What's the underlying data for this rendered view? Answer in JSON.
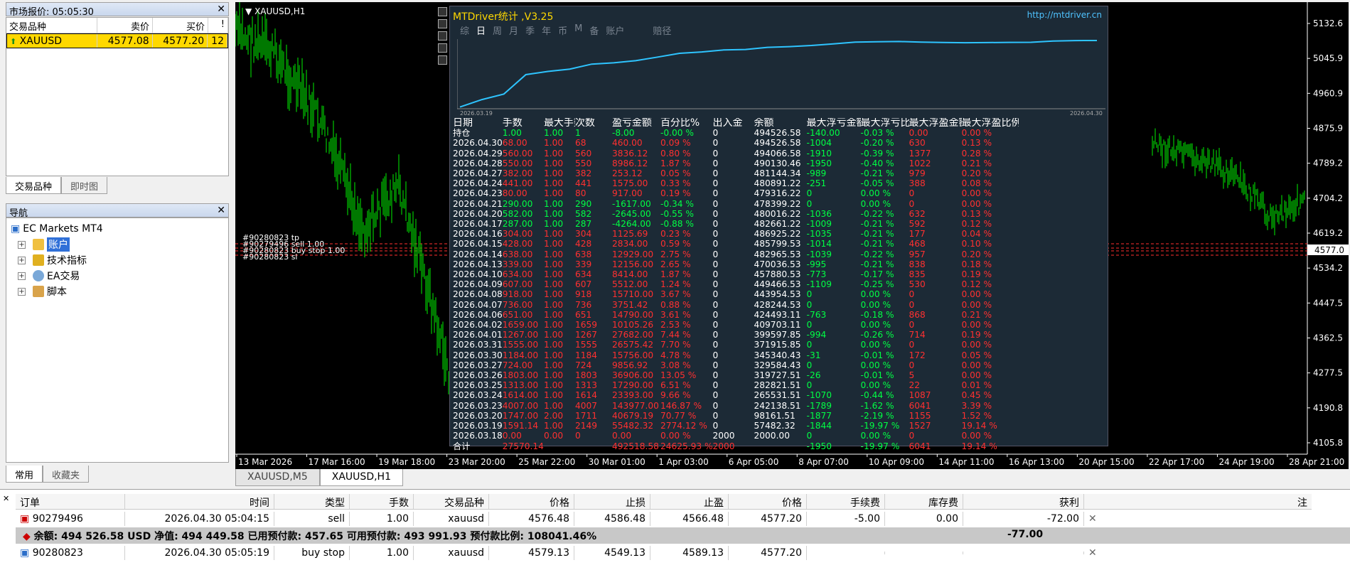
{
  "market_watch": {
    "title": "市场报价: 05:05:30",
    "columns": [
      "交易品种",
      "卖价",
      "买价",
      "!"
    ],
    "rows": [
      {
        "symbol": "XAUUSD",
        "bid": "4577.08",
        "ask": "4577.20",
        "spread": "12"
      }
    ],
    "tabs": [
      "交易品种",
      "即时图"
    ]
  },
  "navigator": {
    "title": "导航",
    "root": "EC Markets MT4",
    "items": [
      "账户",
      "技术指标",
      "EA交易",
      "脚本"
    ],
    "tabs": [
      "常用",
      "收藏夹"
    ]
  },
  "chart": {
    "symbol_label": "XAUUSD,H1",
    "price_ticks": [
      "5132.6",
      "5045.9",
      "4960.9",
      "4875.9",
      "4789.2",
      "4704.2",
      "4619.2",
      "4534.2",
      "4447.5",
      "4362.5",
      "4277.5",
      "4190.8",
      "4105.8"
    ],
    "current_price": "4577.0",
    "time_ticks": [
      "13 Mar 2026",
      "17 Mar 16:00",
      "19 Mar 18:00",
      "23 Mar 20:00",
      "25 Mar 22:00",
      "30 Mar 01:00",
      "1 Apr 03:00",
      "6 Apr 05:00",
      "8 Apr 07:00",
      "10 Apr 09:00",
      "14 Apr 11:00",
      "16 Apr 13:00",
      "20 Apr 15:00",
      "22 Apr 17:00",
      "24 Apr 19:00",
      "28 Apr 21:00"
    ],
    "order_labels": [
      "#90280823 tp",
      "#90279496 sell 1.00",
      "#90280823 buy stop 1.00",
      "#90280823 sl"
    ],
    "tabs": [
      "XAUUSD,M5",
      "XAUUSD,H1"
    ],
    "accent": "#00c800"
  },
  "stats_panel": {
    "title": "MTDriver统计 ,V3.25",
    "url": "http://mtdriver.cn",
    "periods": [
      "综",
      "日",
      "周",
      "月",
      "季",
      "年",
      "币",
      "M",
      "备",
      "账户",
      "赔径"
    ],
    "equity_start_date": "2026.03.19",
    "equity_end_date": "2026.04.30",
    "columns": [
      "日期",
      "手数",
      "最大手数",
      "次数",
      "盈亏金额",
      "百分比%",
      "出入金",
      "余额",
      "最大浮亏金额",
      "最大浮亏比例",
      "最大浮盈金额",
      "最大浮盈比例"
    ],
    "rows": [
      [
        "持仓",
        "1.00",
        "1.00",
        "1",
        "-8.00",
        "-0.00 %",
        "0",
        "494526.58",
        "-140.00",
        "-0.03 %",
        "0.00",
        "0.00 %"
      ],
      [
        "2026.04.30",
        "68.00",
        "1.00",
        "68",
        "460.00",
        "0.09 %",
        "0",
        "494526.58",
        "-1004",
        "-0.20 %",
        "630",
        "0.13 %"
      ],
      [
        "2026.04.29",
        "560.00",
        "1.00",
        "560",
        "3836.12",
        "0.80 %",
        "0",
        "494066.58",
        "-1910",
        "-0.39 %",
        "1377",
        "0.28 %"
      ],
      [
        "2026.04.28",
        "550.00",
        "1.00",
        "550",
        "8986.12",
        "1.87 %",
        "0",
        "490130.46",
        "-1950",
        "-0.40 %",
        "1022",
        "0.21 %"
      ],
      [
        "2026.04.27",
        "382.00",
        "1.00",
        "382",
        "253.12",
        "0.05 %",
        "0",
        "481144.34",
        "-989",
        "-0.21 %",
        "979",
        "0.20 %"
      ],
      [
        "2026.04.24",
        "441.00",
        "1.00",
        "441",
        "1575.00",
        "0.33 %",
        "0",
        "480891.22",
        "-251",
        "-0.05 %",
        "388",
        "0.08 %"
      ],
      [
        "2026.04.23",
        "80.00",
        "1.00",
        "80",
        "917.00",
        "0.19 %",
        "0",
        "479316.22",
        "0",
        "0.00 %",
        "0",
        "0.00 %"
      ],
      [
        "2026.04.21",
        "290.00",
        "1.00",
        "290",
        "-1617.00",
        "-0.34 %",
        "0",
        "478399.22",
        "0",
        "0.00 %",
        "0",
        "0.00 %"
      ],
      [
        "2026.04.20",
        "582.00",
        "1.00",
        "582",
        "-2645.00",
        "-0.55 %",
        "0",
        "480016.22",
        "-1036",
        "-0.22 %",
        "632",
        "0.13 %"
      ],
      [
        "2026.04.17",
        "287.00",
        "1.00",
        "287",
        "-4264.00",
        "-0.88 %",
        "0",
        "482661.22",
        "-1009",
        "-0.21 %",
        "592",
        "0.12 %"
      ],
      [
        "2026.04.16",
        "304.00",
        "1.00",
        "304",
        "1125.69",
        "0.23 %",
        "0",
        "486925.22",
        "-1035",
        "-0.21 %",
        "177",
        "0.04 %"
      ],
      [
        "2026.04.15",
        "428.00",
        "1.00",
        "428",
        "2834.00",
        "0.59 %",
        "0",
        "485799.53",
        "-1014",
        "-0.21 %",
        "468",
        "0.10 %"
      ],
      [
        "2026.04.14",
        "638.00",
        "1.00",
        "638",
        "12929.00",
        "2.75 %",
        "0",
        "482965.53",
        "-1039",
        "-0.22 %",
        "957",
        "0.20 %"
      ],
      [
        "2026.04.13",
        "339.00",
        "1.00",
        "339",
        "12156.00",
        "2.65 %",
        "0",
        "470036.53",
        "-995",
        "-0.21 %",
        "838",
        "0.18 %"
      ],
      [
        "2026.04.10",
        "634.00",
        "1.00",
        "634",
        "8414.00",
        "1.87 %",
        "0",
        "457880.53",
        "-773",
        "-0.17 %",
        "835",
        "0.19 %"
      ],
      [
        "2026.04.09",
        "607.00",
        "1.00",
        "607",
        "5512.00",
        "1.24 %",
        "0",
        "449466.53",
        "-1109",
        "-0.25 %",
        "530",
        "0.12 %"
      ],
      [
        "2026.04.08",
        "918.00",
        "1.00",
        "918",
        "15710.00",
        "3.67 %",
        "0",
        "443954.53",
        "0",
        "0.00 %",
        "0",
        "0.00 %"
      ],
      [
        "2026.04.07",
        "736.00",
        "1.00",
        "736",
        "3751.42",
        "0.88 %",
        "0",
        "428244.53",
        "0",
        "0.00 %",
        "0",
        "0.00 %"
      ],
      [
        "2026.04.06",
        "651.00",
        "1.00",
        "651",
        "14790.00",
        "3.61 %",
        "0",
        "424493.11",
        "-763",
        "-0.18 %",
        "868",
        "0.21 %"
      ],
      [
        "2026.04.02",
        "1659.00",
        "1.00",
        "1659",
        "10105.26",
        "2.53 %",
        "0",
        "409703.11",
        "0",
        "0.00 %",
        "0",
        "0.00 %"
      ],
      [
        "2026.04.01",
        "1267.00",
        "1.00",
        "1267",
        "27682.00",
        "7.44 %",
        "0",
        "399597.85",
        "-994",
        "-0.26 %",
        "714",
        "0.19 %"
      ],
      [
        "2026.03.31",
        "1555.00",
        "1.00",
        "1555",
        "26575.42",
        "7.70 %",
        "0",
        "371915.85",
        "0",
        "0.00 %",
        "0",
        "0.00 %"
      ],
      [
        "2026.03.30",
        "1184.00",
        "1.00",
        "1184",
        "15756.00",
        "4.78 %",
        "0",
        "345340.43",
        "-31",
        "-0.01 %",
        "172",
        "0.05 %"
      ],
      [
        "2026.03.27",
        "724.00",
        "1.00",
        "724",
        "9856.92",
        "3.08 %",
        "0",
        "329584.43",
        "0",
        "0.00 %",
        "0",
        "0.00 %"
      ],
      [
        "2026.03.26",
        "1803.00",
        "1.00",
        "1803",
        "36906.00",
        "13.05 %",
        "0",
        "319727.51",
        "-26",
        "-0.01 %",
        "5",
        "0.00 %"
      ],
      [
        "2026.03.25",
        "1313.00",
        "1.00",
        "1313",
        "17290.00",
        "6.51 %",
        "0",
        "282821.51",
        "0",
        "0.00 %",
        "22",
        "0.01 %"
      ],
      [
        "2026.03.24",
        "1614.00",
        "1.00",
        "1614",
        "23393.00",
        "9.66 %",
        "0",
        "265531.51",
        "-1070",
        "-0.44 %",
        "1087",
        "0.45 %"
      ],
      [
        "2026.03.23",
        "4007.00",
        "1.00",
        "4007",
        "143977.00",
        "146.87 %",
        "0",
        "242138.51",
        "-1789",
        "-1.62 %",
        "6041",
        "3.39 %"
      ],
      [
        "2026.03.20",
        "1747.00",
        "2.00",
        "1711",
        "40679.19",
        "70.77 %",
        "0",
        "98161.51",
        "-1877",
        "-2.19 %",
        "1155",
        "1.52 %"
      ],
      [
        "2026.03.19",
        "1591.14",
        "1.00",
        "2149",
        "55482.32",
        "2774.12 %",
        "0",
        "57482.32",
        "-1844",
        "-19.97 %",
        "1527",
        "19.14 %"
      ],
      [
        "2026.03.18",
        "0.00",
        "0.00",
        "0",
        "0.00",
        "0.00 %",
        "2000",
        "2000.00",
        "0",
        "0.00 %",
        "0",
        "0.00 %"
      ],
      [
        "合计",
        "27570.14",
        "",
        "",
        "492518.58",
        "24625.93 %",
        "2000",
        "",
        "-1950",
        "-19.97 %",
        "6041",
        "19.14 %"
      ]
    ]
  },
  "orders": {
    "columns": [
      "订单",
      "时间",
      "类型",
      "手数",
      "交易品种",
      "价格",
      "止损",
      "止盈",
      "价格",
      "手续费",
      "库存费",
      "获利",
      "注"
    ],
    "rows": [
      {
        "ticket": "90279496",
        "time": "2026.04.30 05:04:15",
        "type": "sell",
        "lots": "1.00",
        "symbol": "xauusd",
        "price": "4576.48",
        "sl": "4586.48",
        "tp": "4566.48",
        "cur": "4577.20",
        "comm": "-5.00",
        "swap": "0.00",
        "profit": "-72.00"
      },
      {
        "ticket": "90280823",
        "time": "2026.04.30 05:05:19",
        "type": "buy stop",
        "lots": "1.00",
        "symbol": "xauusd",
        "price": "4579.13",
        "sl": "4549.13",
        "tp": "4589.13",
        "cur": "4577.20",
        "comm": "",
        "swap": "",
        "profit": ""
      }
    ],
    "balance_line": "余额: 494 526.58 USD  净值: 494 449.58  已用预付款: 457.65  可用预付款: 493 991.93  预付款比例: 108041.46%",
    "balance_profit": "-77.00"
  }
}
